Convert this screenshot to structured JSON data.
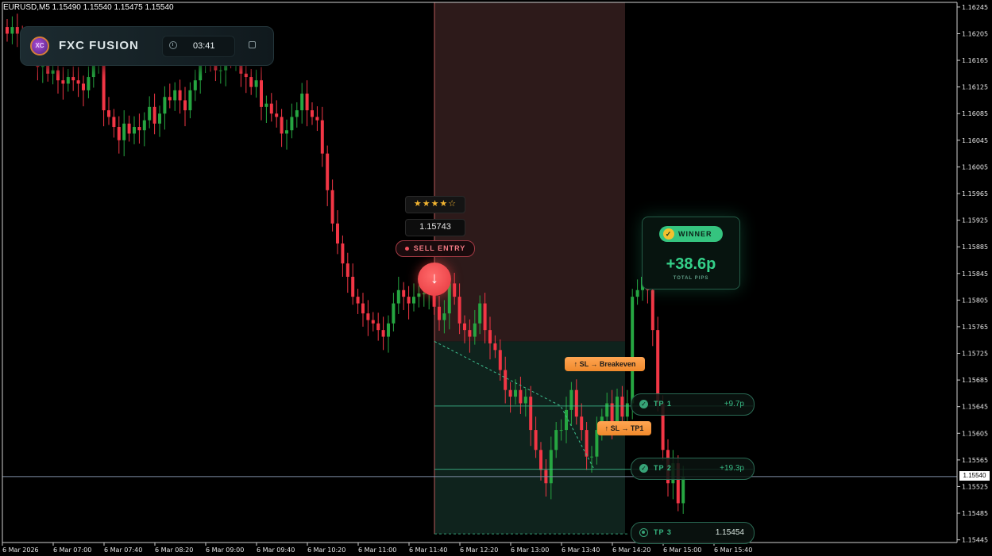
{
  "symbol_line": "EURUSD,M5  1.15490 1.15540 1.15475 1.15540",
  "panel": {
    "brand": "FXC FUSION",
    "logo_text": "XC",
    "timer": "03:41",
    "logo_icon": "fxc-logo-icon",
    "clock_icon": "clock-icon",
    "stop_icon": "stop-square-icon"
  },
  "signal": {
    "stars": "★★★★☆",
    "rating": 4,
    "rating_max": 5,
    "entry_price": "1.15743",
    "entry_label": "SELL ENTRY",
    "arrow_glyph": "↓",
    "arrow_icon": "sell-arrow-down-icon"
  },
  "tags": {
    "sl_breakeven": "↑ SL → Breakeven",
    "sl_tp1": "↑ SL → TP1"
  },
  "winner": {
    "badge": "WINNER",
    "badge_glyph": "✓",
    "pips": "+38.6p",
    "caption": "TOTAL PIPS"
  },
  "targets": [
    {
      "name": "TP 1",
      "value": "+9.7p",
      "glyph": "✓",
      "hit": true
    },
    {
      "name": "TP 2",
      "value": "+19.3p",
      "glyph": "✓",
      "hit": true
    },
    {
      "name": "TP 3",
      "value": "1.15454",
      "glyph": "",
      "hit": false
    }
  ],
  "current_price": "1.15540",
  "colors": {
    "bull": "#26a641",
    "bear": "#f23645",
    "zone_red": "#2d1a1a",
    "zone_green": "#0f231d",
    "tp_line": "#3fbf8f",
    "price_line": "#7f8fa6"
  },
  "chart_data": {
    "type": "candlestick",
    "symbol": "EURUSD",
    "timeframe": "M5",
    "ohlc_last": {
      "open": 1.1549,
      "high": 1.1554,
      "low": 1.15475,
      "close": 1.1554
    },
    "price_axis_ticks": [
      "1.16245",
      "1.16205",
      "1.16165",
      "1.16125",
      "1.16085",
      "1.16045",
      "1.16005",
      "1.15965",
      "1.15925",
      "1.15885",
      "1.15845",
      "1.15805",
      "1.15765",
      "1.15725",
      "1.15685",
      "1.15645",
      "1.15605",
      "1.15565",
      "1.15525",
      "1.15485",
      "1.15445"
    ],
    "time_axis_ticks": [
      "6 Mar 2026",
      "6 Mar 07:00",
      "6 Mar 07:40",
      "6 Mar 08:20",
      "6 Mar 09:00",
      "6 Mar 09:40",
      "6 Mar 10:20",
      "6 Mar 11:00",
      "6 Mar 11:40",
      "6 Mar 12:20",
      "6 Mar 13:00",
      "6 Mar 13:40",
      "6 Mar 14:20",
      "6 Mar 15:00",
      "6 Mar 15:40"
    ],
    "ylim": [
      1.15441,
      1.16252
    ],
    "trade": {
      "direction": "sell",
      "entry": 1.15743,
      "stop_loss_zone_top": 1.16252,
      "tp1": 1.15646,
      "tp2": 1.15551,
      "tp3": 1.15454
    },
    "candles_close": [
      1.16205,
      1.16215,
      1.16205,
      1.16185,
      1.1619,
      1.16175,
      1.16155,
      1.16165,
      1.16145,
      1.1615,
      1.16135,
      1.1613,
      1.1614,
      1.16135,
      1.1613,
      1.1612,
      1.1614,
      1.16165,
      1.1617,
      1.1609,
      1.1608,
      1.16065,
      1.16045,
      1.1607,
      1.16055,
      1.16065,
      1.1606,
      1.16075,
      1.16095,
      1.1607,
      1.16085,
      1.1611,
      1.16105,
      1.1612,
      1.16105,
      1.1609,
      1.1612,
      1.16135,
      1.1617,
      1.1618,
      1.1616,
      1.1615,
      1.1615,
      1.1618,
      1.16165,
      1.16165,
      1.16145,
      1.1614,
      1.16125,
      1.16135,
      1.16095,
      1.161,
      1.16085,
      1.1608,
      1.16055,
      1.1606,
      1.1608,
      1.1609,
      1.16115,
      1.1609,
      1.1608,
      1.16075,
      1.16025,
      1.1597,
      1.1592,
      1.1589,
      1.1586,
      1.1584,
      1.1581,
      1.158,
      1.15785,
      1.15775,
      1.1577,
      1.1576,
      1.1575,
      1.1577,
      1.158,
      1.1582,
      1.1581,
      1.158,
      1.1581,
      1.15815,
      1.15815,
      1.1582,
      1.15795,
      1.15775,
      1.15785,
      1.1583,
      1.1581,
      1.1577,
      1.1576,
      1.1575,
      1.1577,
      1.158,
      1.1576,
      1.1574,
      1.1573,
      1.157,
      1.1567,
      1.1566,
      1.1567,
      1.1565,
      1.1566,
      1.1561,
      1.1558,
      1.1555,
      1.1553,
      1.1558,
      1.1561,
      1.1561,
      1.1564,
      1.1567,
      1.1563,
      1.1561,
      1.1557,
      1.1557,
      1.1561,
      1.1563,
      1.1565,
      1.1562,
      1.1566,
      1.1563,
      1.1565,
      1.1581,
      1.1582,
      1.1584,
      1.1582,
      1.1576,
      1.1565,
      1.1558,
      1.1553,
      1.1556,
      1.155,
      1.1554
    ]
  }
}
